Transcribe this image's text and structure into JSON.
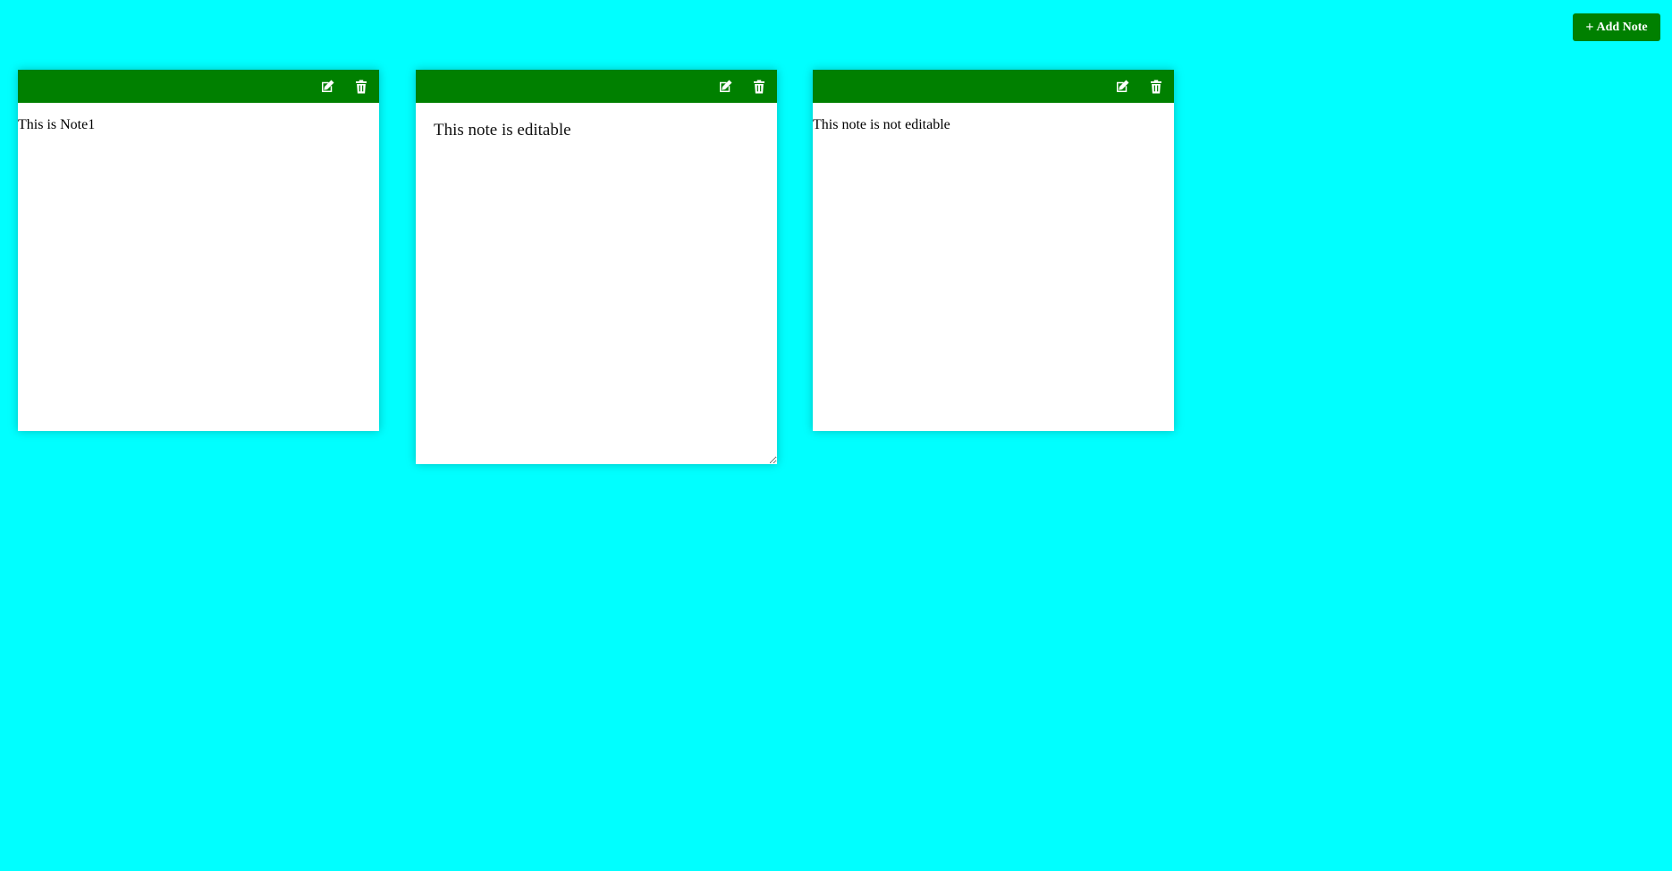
{
  "toolbar": {
    "add_note_label": "Add Note"
  },
  "colors": {
    "background": "#00ffff",
    "accent": "#008000",
    "note_background": "#ffffff"
  },
  "notes": [
    {
      "text": "This is Note1",
      "mode": "read-only"
    },
    {
      "text": "This note is editable",
      "mode": "editing"
    },
    {
      "text": "This note is not editable",
      "mode": "read-only"
    }
  ],
  "icons": {
    "add": "plus-icon",
    "edit": "edit-icon",
    "delete": "trash-icon"
  }
}
